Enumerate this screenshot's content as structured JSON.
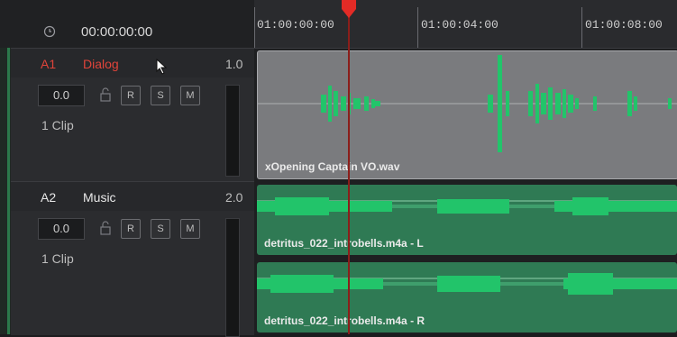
{
  "header": {
    "timecode": "00:00:00:00"
  },
  "ruler": {
    "labels": [
      "01:00:00:00",
      "01:00:04:00",
      "01:00:08:00"
    ]
  },
  "tracks": [
    {
      "id": "A1",
      "name": "Dialog",
      "type_value": "1.0",
      "volume": "0.0",
      "buttons": [
        "R",
        "S",
        "M"
      ],
      "clip_count": "1 Clip",
      "name_color": "#e0443a"
    },
    {
      "id": "A2",
      "name": "Music",
      "type_value": "2.0",
      "volume": "0.0",
      "buttons": [
        "R",
        "S",
        "M"
      ],
      "clip_count": "1 Clip",
      "name_color": "#e8e8e8"
    }
  ],
  "clips": [
    {
      "name": "xOpening Captain VO.wav",
      "color": "#7a7b7e"
    },
    {
      "name": "detritus_022_introbells.m4a - L",
      "color": "#2f7a54"
    },
    {
      "name": "detritus_022_introbells.m4a - R",
      "color": "#2f7a54"
    }
  ],
  "colors": {
    "waveform": "#22c46a",
    "playhead": "#e32b26"
  },
  "icons": [
    "clock-icon",
    "lock-icon",
    "cursor-icon",
    "playhead-icon"
  ]
}
